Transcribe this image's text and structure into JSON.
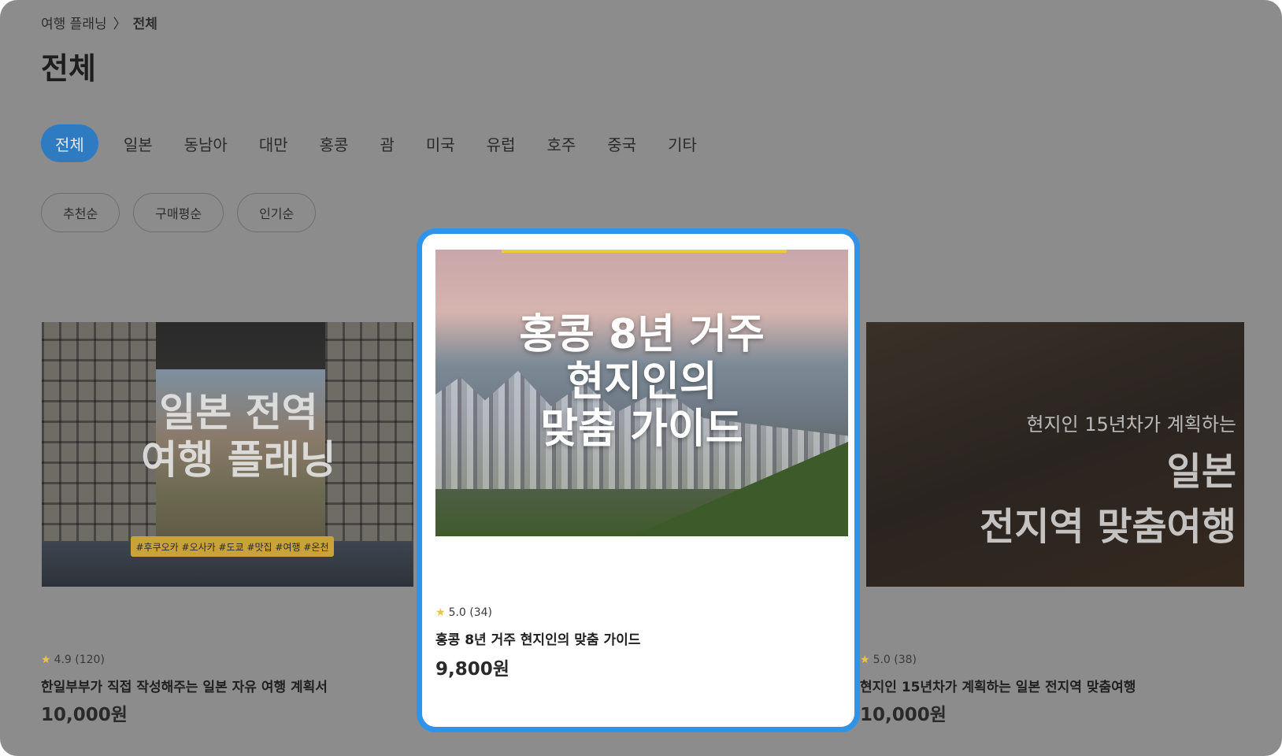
{
  "breadcrumb": {
    "parent": "여행 플래닝",
    "separator": "〉",
    "current": "전체"
  },
  "page_title": "전체",
  "tabs": [
    "전체",
    "일본",
    "동남아",
    "대만",
    "홍콩",
    "괌",
    "미국",
    "유럽",
    "호주",
    "중국",
    "기타"
  ],
  "active_tab": "전체",
  "sort_buttons": [
    "추천순",
    "구매평순",
    "인기순"
  ],
  "products": [
    {
      "image_text_line1": "일본 전역",
      "image_text_line2": "여행 플래닝",
      "image_tags": "#후쿠오카 #오사카 #도쿄 #맛집 #여행 #온천",
      "rating": "4.9 (120)",
      "title": "한일부부가 직접 작성해주는 일본 자유 여행 계획서",
      "price": "10,000원"
    },
    {
      "image_text_line1": "홍콩 8년 거주",
      "image_text_line2": "현지인의",
      "image_text_line3": "맞춤 가이드",
      "rating": "5.0 (34)",
      "title": "홍콩 8년 거주 현지인의 맞춤 가이드",
      "price": "9,800원"
    },
    {
      "image_text_line1": "현지인 15년차가 계획하는",
      "image_text_line2": "일본",
      "image_text_line3": "전지역 맞춤여행",
      "rating": "5.0 (38)",
      "title": "현지인 15년차가 계획하는 일본 전지역 맞춤여행",
      "price": "10,000원"
    }
  ],
  "colors": {
    "overlay": "#8c8c8c",
    "accent": "#2e7bc2",
    "highlight_border": "#2f94e8",
    "star": "#e8c44a"
  },
  "icons": {
    "star": "star-icon"
  }
}
